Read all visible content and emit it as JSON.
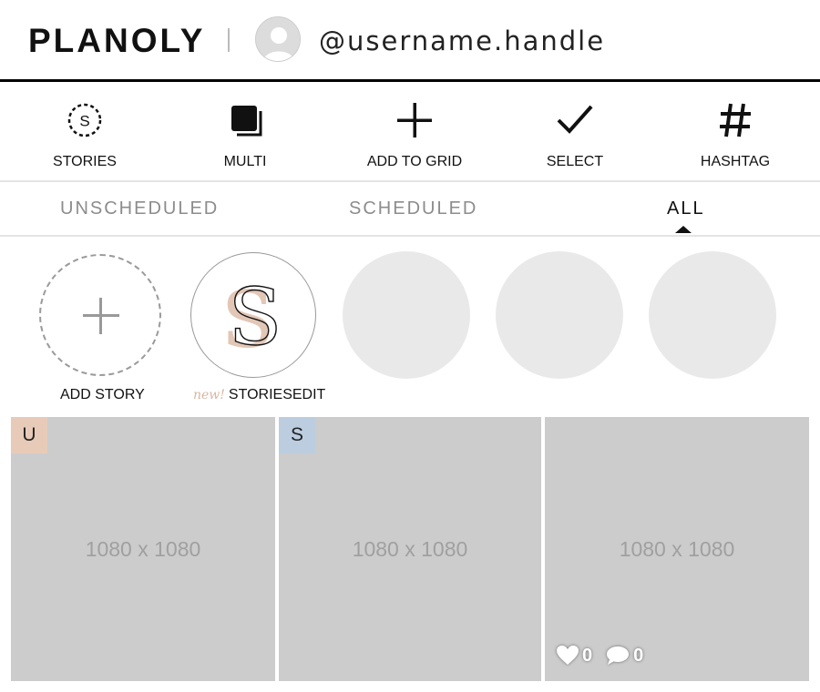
{
  "header": {
    "logo": "PLANOLY",
    "handle": "@username.handle"
  },
  "toolbar": {
    "items": [
      {
        "label": "STORIES",
        "icon": "stories-icon"
      },
      {
        "label": "MULTI",
        "icon": "multi-icon"
      },
      {
        "label": "ADD TO GRID",
        "icon": "plus-icon"
      },
      {
        "label": "SELECT",
        "icon": "checkmark-icon"
      },
      {
        "label": "HASHTAG",
        "icon": "hashtag-icon"
      }
    ],
    "stories_icon_letter": "S"
  },
  "tabs": {
    "items": [
      "UNSCHEDULED",
      "SCHEDULED",
      "ALL"
    ],
    "active": "ALL"
  },
  "stories": {
    "add_label": "ADD STORY",
    "storiesedit_new": "new!",
    "storiesedit_label": "STORIESEDIT",
    "storiesedit_letter": "S"
  },
  "grid": {
    "tiles": [
      {
        "dimensions": "1080 x 1080",
        "badge": "U",
        "badge_color": "#e7cbb8"
      },
      {
        "dimensions": "1080 x 1080",
        "badge": "S",
        "badge_color": "#bccde0"
      },
      {
        "dimensions": "1080 x 1080",
        "likes": "0",
        "comments": "0"
      }
    ]
  },
  "colors": {
    "accent_peach": "#e7cbb8",
    "accent_blue": "#bccde0",
    "tile_bg": "#cccccc",
    "placeholder_circle": "#e9e9e9"
  }
}
